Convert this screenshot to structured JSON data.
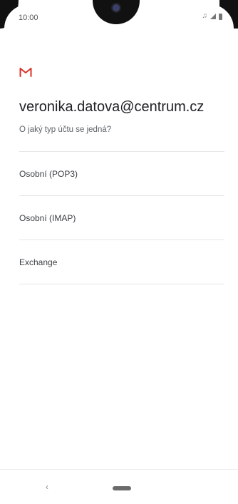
{
  "status_bar": {
    "time": "10:00",
    "icons": [
      "music-note-icon",
      "signal-icon",
      "battery-icon"
    ]
  },
  "app": {
    "logo": "gmail-logo",
    "brand_color": "#d93025"
  },
  "account": {
    "email": "veronika.datova@centrum.cz",
    "question": "O jaký typ účtu se jedná?"
  },
  "options": [
    {
      "label": "Osobní (POP3)"
    },
    {
      "label": "Osobní (IMAP)"
    },
    {
      "label": "Exchange"
    }
  ],
  "nav_bar": {
    "back_glyph": "‹"
  }
}
